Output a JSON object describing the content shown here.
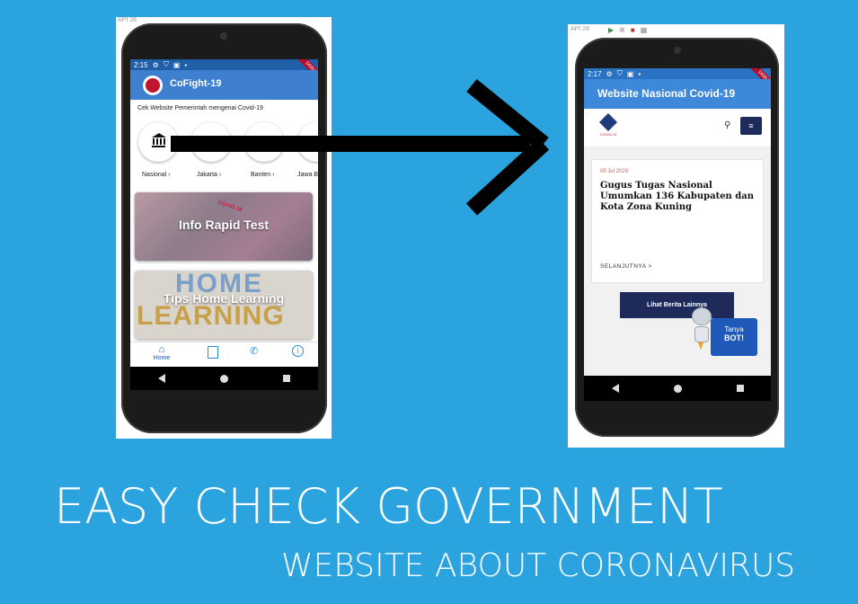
{
  "caption": {
    "line1": "EASY CHECK GOVERNMENT",
    "line2": "WEBSITE ABOUT CORONAVIRUS"
  },
  "left_phone": {
    "status_time": "2:15",
    "debug_ribbon": "DEBUG",
    "app_title": "CoFight-19",
    "subtitle": "Cek Website Pemerintah mengenai Covid-19",
    "regions": [
      {
        "label": "Nasional ›"
      },
      {
        "label": "Jakarta ›"
      },
      {
        "label": "Banten ›"
      },
      {
        "label": "Jawa B"
      }
    ],
    "banner1": "Info Rapid Test",
    "banner1_sub": "COVID-19",
    "banner2": "Tips Home Learning",
    "banner2_bg1": "HOME",
    "banner2_bg2": "LEARNING",
    "bottom_nav": [
      {
        "label": "Home",
        "icon": "home-icon"
      },
      {
        "label": "",
        "icon": "document-icon"
      },
      {
        "label": "",
        "icon": "phone-icon"
      },
      {
        "label": "",
        "icon": "info-icon"
      }
    ],
    "ide_toolbar": "API 28"
  },
  "right_phone": {
    "status_time": "2:17",
    "debug_ribbon": "DEBUG",
    "appbar_title": "Website Nasional Covid-19",
    "ide_toolbar": "API 28",
    "logo_caption": "COVID-19",
    "article": {
      "date": "05 Jul 2020",
      "title": "Gugus Tugas Nasional Umumkan 136 Kabupaten dan Kota Zona Kuning",
      "read_more": "SELANJUTNYA >"
    },
    "more_news_button": "Lihat Berita Lainnya",
    "bot_label1": "Tanya",
    "bot_label2": "BOT!"
  },
  "colors": {
    "background": "#2aa3de",
    "left_appbar": "#3f7fd0",
    "right_appbar": "#3d88d9",
    "navy_button": "#1d2a5a"
  }
}
